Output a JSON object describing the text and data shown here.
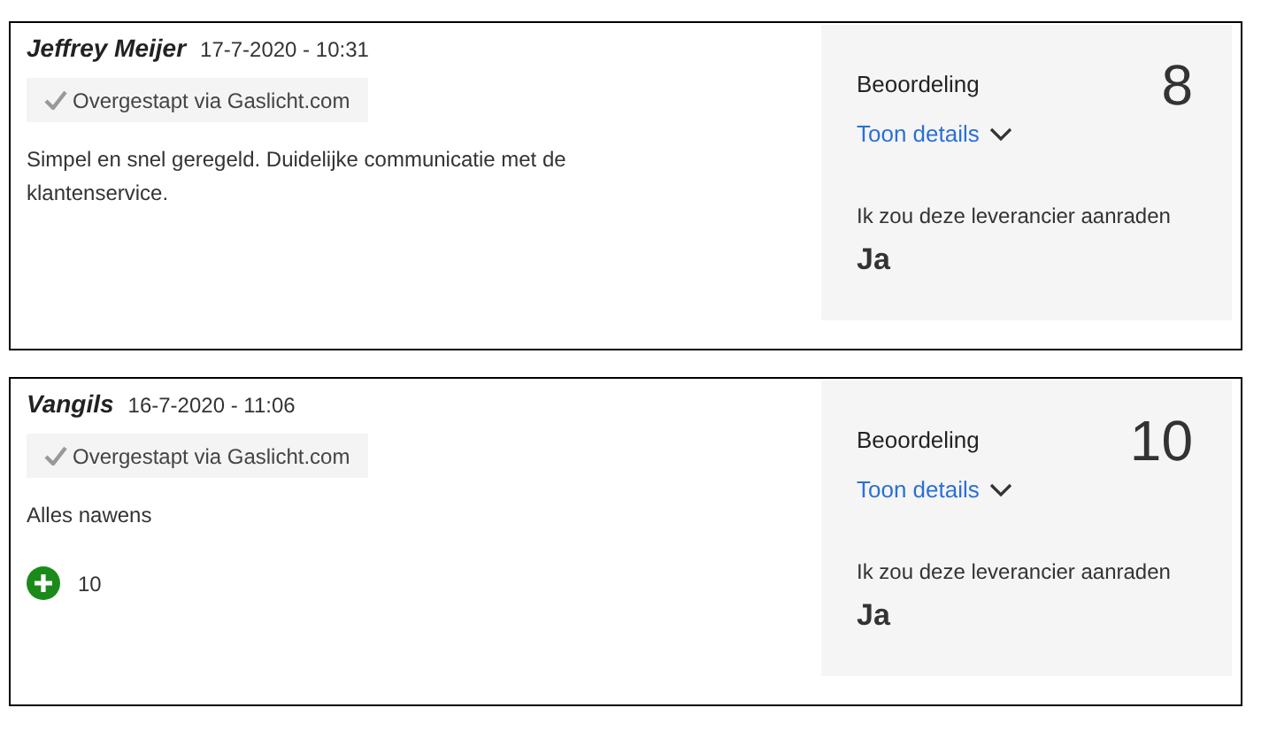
{
  "reviews": [
    {
      "author": "Jeffrey Meijer",
      "date": "17-7-2020 - 10:31",
      "badge": "Overgestapt via Gaslicht.com",
      "text": "Simpel en snel geregeld. Duidelijke communicatie met de klantenservice.",
      "rating_label": "Beoordeling",
      "rating": "8",
      "details_link": "Toon details",
      "recommend_label": "Ik zou deze leverancier aanraden",
      "recommend": "Ja"
    },
    {
      "author": "Vangils",
      "date": "16-7-2020 - 11:06",
      "badge": "Overgestapt via Gaslicht.com",
      "text": "Alles nawens",
      "points": [
        {
          "kind": "plus",
          "text": "10"
        }
      ],
      "rating_label": "Beoordeling",
      "rating": "10",
      "details_link": "Toon details",
      "recommend_label": "Ik zou deze leverancier aanraden",
      "recommend": "Ja"
    }
  ]
}
